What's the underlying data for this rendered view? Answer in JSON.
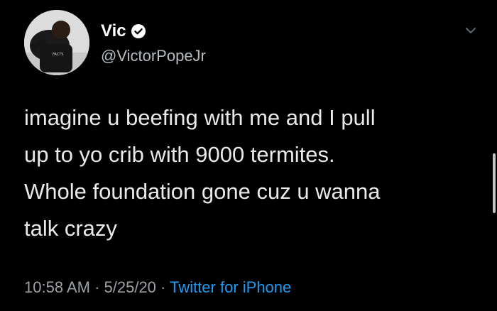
{
  "user": {
    "display_name": "Vic",
    "handle": "@VictorPopeJr",
    "verified": true
  },
  "tweet": {
    "lines": [
      "imagine u beefing with me and I pull",
      "up to yo crib with 9000 termites.",
      "Whole foundation gone cuz u wanna",
      "talk crazy"
    ]
  },
  "meta": {
    "time": "10:58 AM",
    "date": "5/25/20",
    "separator": " · ",
    "source": "Twitter for iPhone"
  },
  "icons": {
    "verified": "verified-badge-icon",
    "menu": "chevron-down-icon"
  },
  "colors": {
    "background": "#000000",
    "text": "#e7e9ea",
    "secondary": "#9aa0a6",
    "link": "#1d9bf0"
  }
}
